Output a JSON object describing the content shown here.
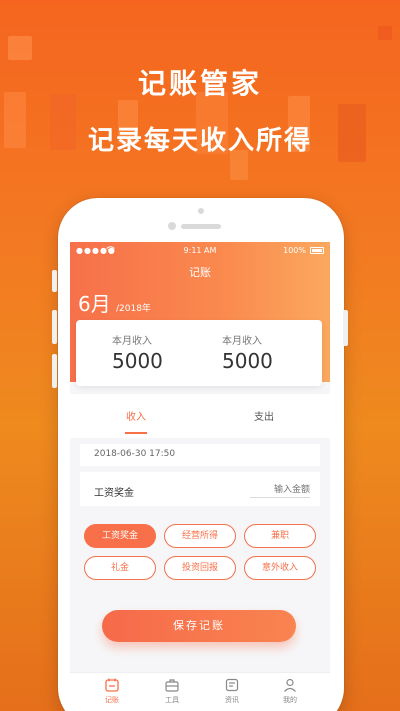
{
  "promo": {
    "title": "记账管家",
    "subtitle": "记录每天收入所得"
  },
  "status_bar": {
    "signal": "●●●●●",
    "time": "9:11 AM",
    "battery": "100%"
  },
  "app": {
    "nav_title": "记账",
    "month": "6月",
    "year": "/2018年",
    "summary": [
      {
        "label": "本月收入",
        "value": "5000"
      },
      {
        "label": "本月收入",
        "value": "5000"
      }
    ],
    "tabs": [
      {
        "label": "收入"
      },
      {
        "label": "支出"
      }
    ],
    "date": "2018-06-30 17:50",
    "amount_label": "工资奖金",
    "amount_placeholder": "输入金额",
    "categories": [
      {
        "label": "工资奖金"
      },
      {
        "label": "经营所得"
      },
      {
        "label": "兼职"
      },
      {
        "label": "礼金"
      },
      {
        "label": "投资回报"
      },
      {
        "label": "意外收入"
      }
    ],
    "save_label": "保存记账",
    "bottom_nav": [
      {
        "label": "记账",
        "icon": "calendar-icon"
      },
      {
        "label": "工具",
        "icon": "briefcase-icon"
      },
      {
        "label": "资讯",
        "icon": "news-icon"
      },
      {
        "label": "我的",
        "icon": "person-icon"
      }
    ]
  },
  "colors": {
    "accent": "#f7704a",
    "background_top": "#f5651f",
    "background_bottom": "#e56f1b"
  }
}
